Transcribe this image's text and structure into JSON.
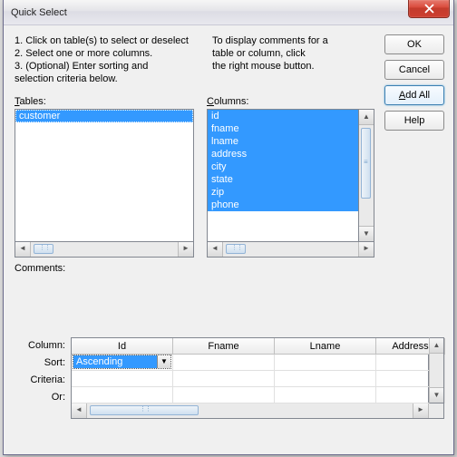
{
  "title": "Quick Select",
  "instructions": {
    "line1": "1. Click on table(s) to select or deselect",
    "line2": "2. Select one or more columns.",
    "line3": "3. (Optional) Enter sorting and",
    "line3b": "    selection criteria below.",
    "display1": "To display comments for a",
    "display2": "table or column, click",
    "display3": "the right mouse button."
  },
  "buttons": {
    "ok": "OK",
    "cancel": "Cancel",
    "addall": "Add All",
    "help": "Help"
  },
  "tables_label": "Tables:",
  "columns_label": "Columns:",
  "comments_label": "Comments:",
  "tables": [
    {
      "label": "customer",
      "selected": true
    }
  ],
  "columns": [
    {
      "label": "id",
      "selected": true
    },
    {
      "label": "fname",
      "selected": true
    },
    {
      "label": "lname",
      "selected": true
    },
    {
      "label": "address",
      "selected": true
    },
    {
      "label": "city",
      "selected": true
    },
    {
      "label": "state",
      "selected": true
    },
    {
      "label": "zip",
      "selected": true
    },
    {
      "label": "phone",
      "selected": true
    }
  ],
  "grid": {
    "row_labels": [
      "Column:",
      "Sort:",
      "Criteria:",
      "Or:"
    ],
    "headers": [
      "Id",
      "Fname",
      "Lname",
      "Address"
    ],
    "sort_selected": "Ascending"
  }
}
